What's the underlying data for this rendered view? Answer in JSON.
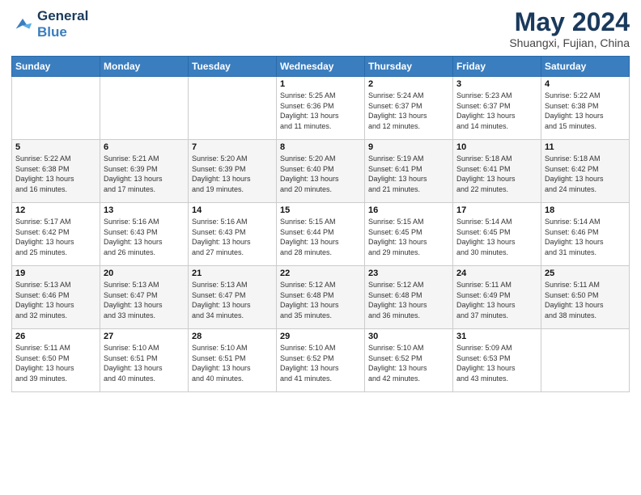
{
  "logo": {
    "line1": "General",
    "line2": "Blue"
  },
  "calendar": {
    "title": "May 2024",
    "subtitle": "Shuangxi, Fujian, China",
    "headers": [
      "Sunday",
      "Monday",
      "Tuesday",
      "Wednesday",
      "Thursday",
      "Friday",
      "Saturday"
    ],
    "weeks": [
      [
        {
          "day": "",
          "info": ""
        },
        {
          "day": "",
          "info": ""
        },
        {
          "day": "",
          "info": ""
        },
        {
          "day": "1",
          "info": "Sunrise: 5:25 AM\nSunset: 6:36 PM\nDaylight: 13 hours\nand 11 minutes."
        },
        {
          "day": "2",
          "info": "Sunrise: 5:24 AM\nSunset: 6:37 PM\nDaylight: 13 hours\nand 12 minutes."
        },
        {
          "day": "3",
          "info": "Sunrise: 5:23 AM\nSunset: 6:37 PM\nDaylight: 13 hours\nand 14 minutes."
        },
        {
          "day": "4",
          "info": "Sunrise: 5:22 AM\nSunset: 6:38 PM\nDaylight: 13 hours\nand 15 minutes."
        }
      ],
      [
        {
          "day": "5",
          "info": "Sunrise: 5:22 AM\nSunset: 6:38 PM\nDaylight: 13 hours\nand 16 minutes."
        },
        {
          "day": "6",
          "info": "Sunrise: 5:21 AM\nSunset: 6:39 PM\nDaylight: 13 hours\nand 17 minutes."
        },
        {
          "day": "7",
          "info": "Sunrise: 5:20 AM\nSunset: 6:39 PM\nDaylight: 13 hours\nand 19 minutes."
        },
        {
          "day": "8",
          "info": "Sunrise: 5:20 AM\nSunset: 6:40 PM\nDaylight: 13 hours\nand 20 minutes."
        },
        {
          "day": "9",
          "info": "Sunrise: 5:19 AM\nSunset: 6:41 PM\nDaylight: 13 hours\nand 21 minutes."
        },
        {
          "day": "10",
          "info": "Sunrise: 5:18 AM\nSunset: 6:41 PM\nDaylight: 13 hours\nand 22 minutes."
        },
        {
          "day": "11",
          "info": "Sunrise: 5:18 AM\nSunset: 6:42 PM\nDaylight: 13 hours\nand 24 minutes."
        }
      ],
      [
        {
          "day": "12",
          "info": "Sunrise: 5:17 AM\nSunset: 6:42 PM\nDaylight: 13 hours\nand 25 minutes."
        },
        {
          "day": "13",
          "info": "Sunrise: 5:16 AM\nSunset: 6:43 PM\nDaylight: 13 hours\nand 26 minutes."
        },
        {
          "day": "14",
          "info": "Sunrise: 5:16 AM\nSunset: 6:43 PM\nDaylight: 13 hours\nand 27 minutes."
        },
        {
          "day": "15",
          "info": "Sunrise: 5:15 AM\nSunset: 6:44 PM\nDaylight: 13 hours\nand 28 minutes."
        },
        {
          "day": "16",
          "info": "Sunrise: 5:15 AM\nSunset: 6:45 PM\nDaylight: 13 hours\nand 29 minutes."
        },
        {
          "day": "17",
          "info": "Sunrise: 5:14 AM\nSunset: 6:45 PM\nDaylight: 13 hours\nand 30 minutes."
        },
        {
          "day": "18",
          "info": "Sunrise: 5:14 AM\nSunset: 6:46 PM\nDaylight: 13 hours\nand 31 minutes."
        }
      ],
      [
        {
          "day": "19",
          "info": "Sunrise: 5:13 AM\nSunset: 6:46 PM\nDaylight: 13 hours\nand 32 minutes."
        },
        {
          "day": "20",
          "info": "Sunrise: 5:13 AM\nSunset: 6:47 PM\nDaylight: 13 hours\nand 33 minutes."
        },
        {
          "day": "21",
          "info": "Sunrise: 5:13 AM\nSunset: 6:47 PM\nDaylight: 13 hours\nand 34 minutes."
        },
        {
          "day": "22",
          "info": "Sunrise: 5:12 AM\nSunset: 6:48 PM\nDaylight: 13 hours\nand 35 minutes."
        },
        {
          "day": "23",
          "info": "Sunrise: 5:12 AM\nSunset: 6:48 PM\nDaylight: 13 hours\nand 36 minutes."
        },
        {
          "day": "24",
          "info": "Sunrise: 5:11 AM\nSunset: 6:49 PM\nDaylight: 13 hours\nand 37 minutes."
        },
        {
          "day": "25",
          "info": "Sunrise: 5:11 AM\nSunset: 6:50 PM\nDaylight: 13 hours\nand 38 minutes."
        }
      ],
      [
        {
          "day": "26",
          "info": "Sunrise: 5:11 AM\nSunset: 6:50 PM\nDaylight: 13 hours\nand 39 minutes."
        },
        {
          "day": "27",
          "info": "Sunrise: 5:10 AM\nSunset: 6:51 PM\nDaylight: 13 hours\nand 40 minutes."
        },
        {
          "day": "28",
          "info": "Sunrise: 5:10 AM\nSunset: 6:51 PM\nDaylight: 13 hours\nand 40 minutes."
        },
        {
          "day": "29",
          "info": "Sunrise: 5:10 AM\nSunset: 6:52 PM\nDaylight: 13 hours\nand 41 minutes."
        },
        {
          "day": "30",
          "info": "Sunrise: 5:10 AM\nSunset: 6:52 PM\nDaylight: 13 hours\nand 42 minutes."
        },
        {
          "day": "31",
          "info": "Sunrise: 5:09 AM\nSunset: 6:53 PM\nDaylight: 13 hours\nand 43 minutes."
        },
        {
          "day": "",
          "info": ""
        }
      ]
    ]
  }
}
